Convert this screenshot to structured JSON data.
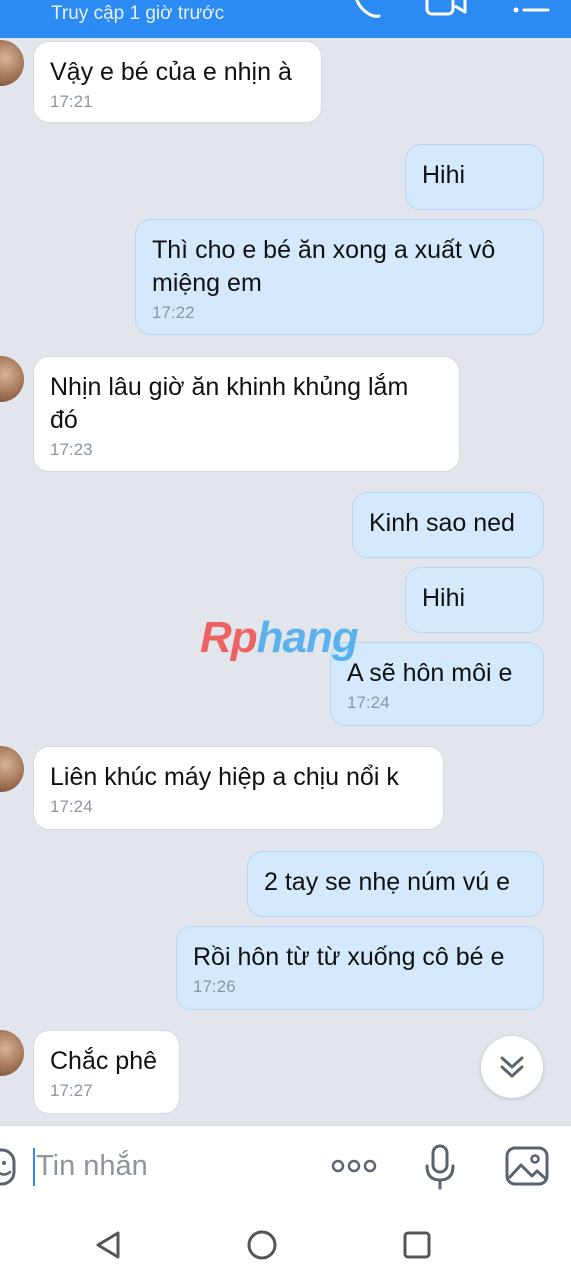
{
  "header": {
    "status": "Truy cập 1 giờ trước"
  },
  "messages": [
    {
      "dir": "in",
      "text": "Vậy e bé của e nhịn à",
      "time": "17:21"
    },
    {
      "dir": "out",
      "text": "Hihi",
      "time": ""
    },
    {
      "dir": "out",
      "text": "Thì cho e bé ăn xong a xuất vô miệng em",
      "time": "17:22"
    },
    {
      "dir": "in",
      "text": "Nhịn lâu giờ ăn khinh khủng lắm đó",
      "time": "17:23"
    },
    {
      "dir": "out",
      "text": "Kinh sao ned",
      "time": ""
    },
    {
      "dir": "out",
      "text": "Hihi",
      "time": ""
    },
    {
      "dir": "out",
      "text": "A sẽ hôn môi e",
      "time": "17:24"
    },
    {
      "dir": "in",
      "text": "Liên khúc máy hiệp a chịu nổi k",
      "time": "17:24"
    },
    {
      "dir": "out",
      "text": "2 tay se nhẹ núm vú e",
      "time": ""
    },
    {
      "dir": "out",
      "text": "Rồi hôn từ từ xuống cô bé e",
      "time": "17:26"
    },
    {
      "dir": "in",
      "text": "Chắc phê",
      "time": "17:27"
    }
  ],
  "watermark": {
    "part1": "Rp",
    "part2": "hang"
  },
  "composer": {
    "placeholder": "Tin nhắn"
  },
  "icons": {
    "call": "phone-icon",
    "video": "video-call-icon",
    "menu": "menu-icon",
    "sticker": "sticker-icon",
    "more": "more-dots-icon",
    "mic": "microphone-icon",
    "image": "image-icon",
    "scroll": "chevron-double-down-icon",
    "back": "nav-back-icon",
    "home": "nav-home-icon",
    "recent": "nav-recent-icon"
  },
  "colors": {
    "accent": "#2b8bf2",
    "outgoing_bubble": "#d4eafc",
    "incoming_bubble": "#ffffff"
  }
}
